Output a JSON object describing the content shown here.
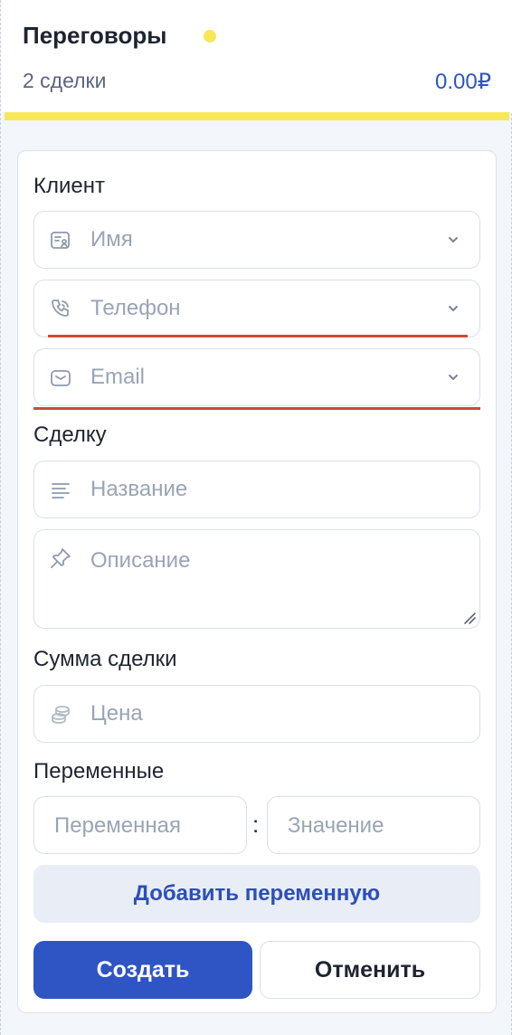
{
  "stage": {
    "title": "Переговоры",
    "deal_count": "2 сделки",
    "total": "0.00₽",
    "accent_color": "#f7e75a"
  },
  "form": {
    "client_label": "Клиент",
    "name_placeholder": "Имя",
    "phone_placeholder": "Телефон",
    "email_placeholder": "Email",
    "deal_label": "Сделку",
    "title_placeholder": "Название",
    "description_placeholder": "Описание",
    "sum_label": "Сумма сделки",
    "price_placeholder": "Цена",
    "variables_label": "Переменные",
    "variable_placeholder": "Переменная",
    "value_placeholder": "Значение",
    "colon": ":",
    "add_variable_label": "Добавить переменную",
    "create_label": "Создать",
    "cancel_label": "Отменить"
  },
  "icons": {
    "name": "contact-card-icon",
    "phone": "phone-icon",
    "email": "envelope-icon",
    "title": "text-lines-icon",
    "description": "pin-icon",
    "price": "coins-icon",
    "dropdown": "chevron-down-icon"
  },
  "colors": {
    "primary": "#2f54c4",
    "error": "#d14a36",
    "placeholder": "#9aa4b5"
  }
}
